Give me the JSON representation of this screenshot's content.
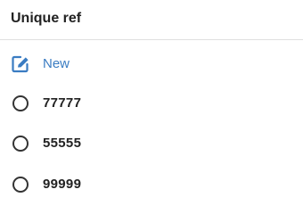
{
  "header": {
    "title": "Unique ref"
  },
  "new_item": {
    "label": "New",
    "icon": "edit-icon",
    "color": "#3a7cc2"
  },
  "options": [
    {
      "label": "77777",
      "selected": false
    },
    {
      "label": "55555",
      "selected": false
    },
    {
      "label": "99999",
      "selected": false
    }
  ]
}
